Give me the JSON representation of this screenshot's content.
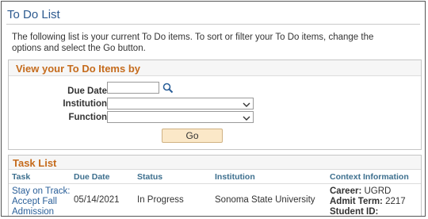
{
  "page": {
    "title": "To Do List",
    "intro": "The following list is your current To Do items. To sort or filter your To Do items, change the options and select the Go button."
  },
  "filter": {
    "header": "View your To Do Items by",
    "due_date_label": "Due Date",
    "due_date_value": "",
    "institution_label": "Institution",
    "institution_value": "",
    "function_label": "Function",
    "function_value": "",
    "go_label": "Go"
  },
  "tasks": {
    "header": "Task List",
    "columns": [
      "Task",
      "Due Date",
      "Status",
      "Institution",
      "Context Information"
    ],
    "rows": [
      {
        "task_line1": "Stay on Track:",
        "task_line2": "Accept Fall",
        "task_line3": "Admission",
        "due_date": "05/14/2021",
        "status": "In Progress",
        "institution": "Sonoma State University",
        "career_label": "Career:",
        "career_value": "UGRD",
        "admit_term_label": "Admit Term:",
        "admit_term_value": "2217",
        "student_id_label": "Student ID:",
        "student_id_value": ""
      }
    ]
  },
  "icons": {
    "lookup": "magnifying-glass-icon",
    "dropdown": "chevron-down-icon"
  },
  "colors": {
    "title_blue": "#2d5a8f",
    "section_orange": "#c56b1c",
    "column_blue": "#3d6f8e",
    "link_blue": "#2a5f99",
    "go_button_bg": "#fbe8c8"
  }
}
